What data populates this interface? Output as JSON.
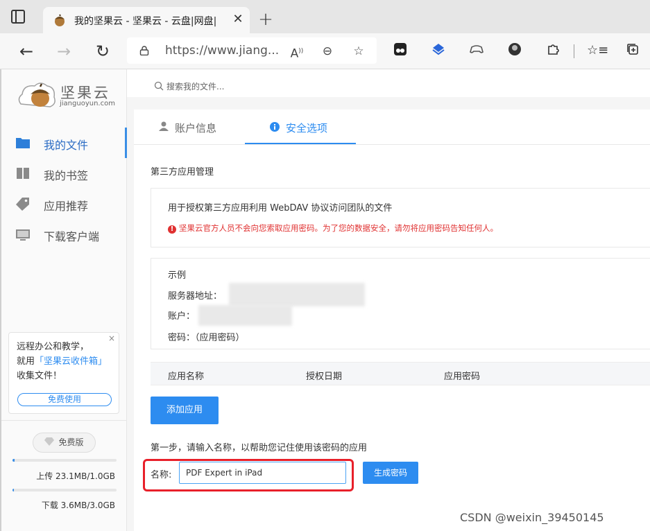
{
  "browser": {
    "tab_title": "我的坚果云 - 坚果云 - 云盘|网盘|",
    "url": "https://www.jiang...",
    "new_tab_label": "+",
    "close_label": "✕"
  },
  "sidebar": {
    "logo_name": "坚果云",
    "logo_domain": "jianguoyun.com",
    "items": [
      {
        "label": "我的文件"
      },
      {
        "label": "我的书签"
      },
      {
        "label": "应用推荐"
      },
      {
        "label": "下载客户端"
      }
    ],
    "promo": {
      "line1": "远程办公和教学，",
      "line2_prefix": "就用",
      "line2_link": "「坚果云收件箱」",
      "line3": "收集文件！",
      "button": "免费使用",
      "close": "×"
    },
    "plan": "免费版",
    "upload": {
      "text": "上传 23.1MB/1.0GB",
      "fraction": 0.023
    },
    "download": {
      "text": "下载 3.6MB/3.0GB",
      "fraction": 0.001
    }
  },
  "search": {
    "placeholder": "搜索我的文件..."
  },
  "tabs": [
    {
      "label": "账户信息"
    },
    {
      "label": "安全选项"
    }
  ],
  "third_party": {
    "title": "第三方应用管理",
    "description": "用于授权第三方应用利用 WebDAV 协议访问团队的文件",
    "warning": "坚果云官方人员不会向您索取应用密码。为了您的数据安全，请勿将应用密码告知任何人。"
  },
  "example": {
    "title": "示例",
    "server_label": "服务器地址：",
    "account_label": "账户：",
    "password_label": "密码：（应用密码）"
  },
  "table": {
    "columns": [
      "应用名称",
      "授权日期",
      "应用密码"
    ]
  },
  "add_button": "添加应用",
  "step_text": "第一步，请输入名称，以帮助您记住使用该密码的应用",
  "form": {
    "name_label": "名称:",
    "name_value": "PDF Expert in iPad",
    "generate_button": "生成密码"
  },
  "watermark": "CSDN @weixin_39450145",
  "colors": {
    "accent": "#2d8cf0",
    "warning": "#e03131",
    "highlight": "#e8202a"
  }
}
